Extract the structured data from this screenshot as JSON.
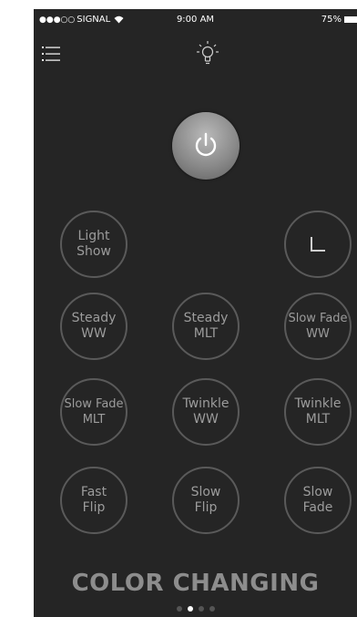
{
  "status_bar": {
    "signal_dots": "●●●○○",
    "carrier": "SIGNAL",
    "time": "9:00 AM",
    "battery": "75%"
  },
  "header": {
    "menu_icon": "hamburger-menu-icon",
    "bulb_icon": "light-bulb-icon"
  },
  "power": {
    "icon": "power-icon"
  },
  "modes": [
    {
      "label": "Light\nShow"
    },
    {
      "label": "",
      "icon": "timer-icon"
    },
    {
      "label": "Steady\nWW"
    },
    {
      "label": "Steady\nMLT"
    },
    {
      "label": "Slow Fade\nWW"
    },
    {
      "label": "Slow Fade\nMLT"
    },
    {
      "label": "Twinkle\nWW"
    },
    {
      "label": "Twinkle\nMLT"
    },
    {
      "label": "Fast\nFlip"
    },
    {
      "label": "Slow\nFlip"
    },
    {
      "label": "Slow\nFade"
    }
  ],
  "footer": {
    "title": "COLOR CHANGING",
    "pages": 4,
    "active_page": 2
  },
  "colors": {
    "background": "#252525",
    "button_border": "#5a5a5a",
    "button_text": "#9c9c9c",
    "title_text": "#8d8d8d"
  }
}
